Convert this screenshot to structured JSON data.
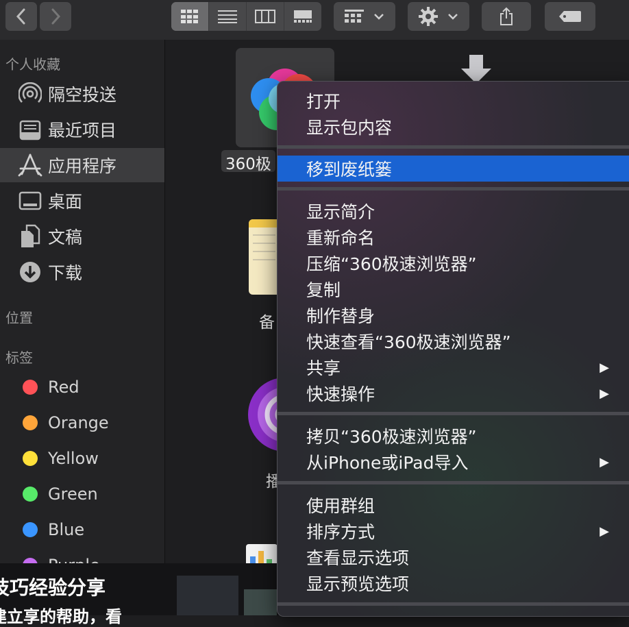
{
  "toolbar": {
    "back_icon": "chevron-left-icon",
    "forward_icon": "chevron-right-icon",
    "views": [
      "icon-view-icon",
      "list-view-icon",
      "column-view-icon",
      "gallery-view-icon"
    ],
    "group_icon": "group-icon",
    "gear_icon": "gear-icon",
    "share_icon": "share-icon",
    "tag_icon": "tag-icon"
  },
  "sidebar": {
    "favorites_title": "个人收藏",
    "favorites": [
      {
        "label": "隔空投送",
        "icon": "airdrop-icon"
      },
      {
        "label": "最近项目",
        "icon": "recents-icon"
      },
      {
        "label": "应用程序",
        "icon": "applications-icon"
      },
      {
        "label": "桌面",
        "icon": "desktop-icon"
      },
      {
        "label": "文稿",
        "icon": "documents-icon"
      },
      {
        "label": "下载",
        "icon": "downloads-icon"
      }
    ],
    "locations_title": "位置",
    "tags_title": "标签",
    "tags": [
      {
        "label": "Red",
        "color": "#ff5257"
      },
      {
        "label": "Orange",
        "color": "#ffa53a"
      },
      {
        "label": "Yellow",
        "color": "#ffe03a"
      },
      {
        "label": "Green",
        "color": "#57ea69"
      },
      {
        "label": "Blue",
        "color": "#3a95ff"
      },
      {
        "label": "Purple",
        "color": "#c56cf0"
      }
    ]
  },
  "content": {
    "files": [
      {
        "label": "360极速浏览器",
        "visible_label": "360极"
      },
      {
        "label": "备忘录",
        "visible_label": "备"
      },
      {
        "label": "播",
        "visible_label": "播"
      }
    ]
  },
  "overlay": {
    "line1": "技巧经验分享",
    "line2": "建立享的帮助，看"
  },
  "menu": {
    "highlight_color": "#1a63d2",
    "items": [
      {
        "label": "打开"
      },
      {
        "label": "显示包内容"
      },
      {
        "label": "移到废纸篓"
      },
      {
        "label": "显示简介"
      },
      {
        "label": "重新命名"
      },
      {
        "label": "压缩“360极速浏览器”"
      },
      {
        "label": "复制"
      },
      {
        "label": "制作替身"
      },
      {
        "label": "快速查看“360极速浏览器”"
      },
      {
        "label": "共享"
      },
      {
        "label": "快速操作"
      },
      {
        "label": "拷贝“360极速浏览器”"
      },
      {
        "label": "从iPhone或iPad导入"
      },
      {
        "label": "使用群组"
      },
      {
        "label": "排序方式"
      },
      {
        "label": "查看显示选项"
      },
      {
        "label": "显示预览选项"
      }
    ],
    "submenu_arrow": "▶"
  }
}
